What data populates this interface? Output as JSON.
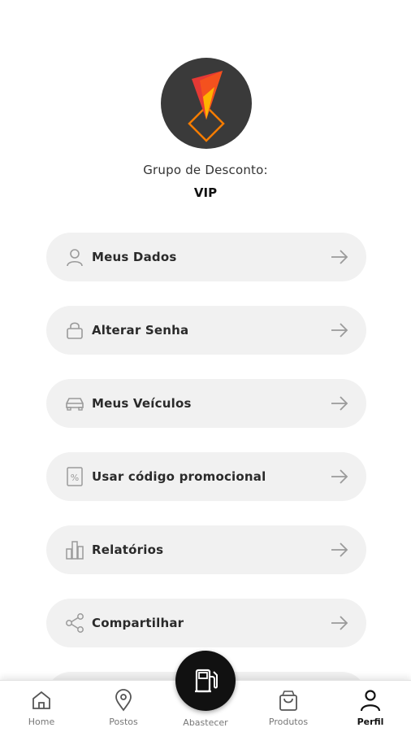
{
  "profile": {
    "group_label": "Grupo de Desconto:",
    "group_value": "VIP"
  },
  "menu": {
    "items": [
      {
        "label": "Meus Dados",
        "icon": "user-icon"
      },
      {
        "label": "Alterar Senha",
        "icon": "lock-icon"
      },
      {
        "label": "Meus Veículos",
        "icon": "car-icon"
      },
      {
        "label": "Usar código promocional",
        "icon": "percent-icon"
      },
      {
        "label": "Relatórios",
        "icon": "bar-chart-icon"
      },
      {
        "label": "Compartilhar",
        "icon": "share-icon"
      }
    ]
  },
  "nav": {
    "home": "Home",
    "postos": "Postos",
    "abastecer": "Abastecer",
    "produtos": "Produtos",
    "perfil": "Perfil"
  },
  "colors": {
    "logo_red": "#e53935",
    "logo_orange": "#f57c00",
    "logo_yellow": "#ffb300",
    "avatar_bg": "#3a3a3a",
    "item_bg": "#f1f1f1",
    "fab_bg": "#111111"
  }
}
